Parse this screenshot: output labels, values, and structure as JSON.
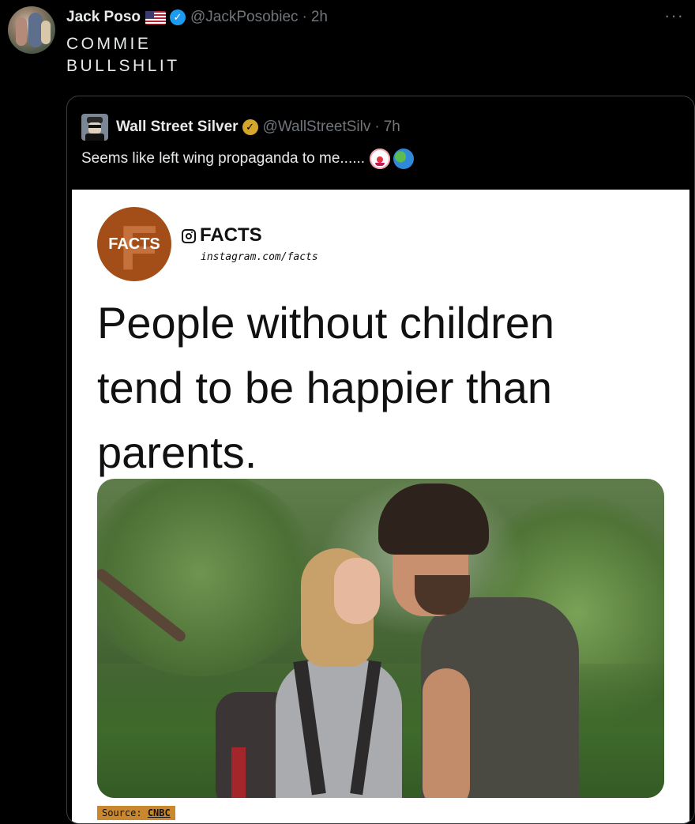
{
  "tweet": {
    "author_name": "Jack Poso",
    "author_handle": "@JackPosobiec",
    "separator": "·",
    "time": "2h",
    "more_label": "···",
    "text_lines": [
      "COMMIE",
      "BULLSHLIT"
    ]
  },
  "quoted": {
    "author_name": "Wall Street Silver",
    "author_handle": "@WallStreetSilv",
    "separator": "·",
    "time": "7h",
    "text": "Seems like left wing propaganda to me......",
    "emojis": [
      "clown-face",
      "globe"
    ]
  },
  "card": {
    "logo_text": "FACTS",
    "logo_letter": "F",
    "account_name": "FACTS",
    "account_url": "instagram.com/facts",
    "headline_lines": [
      "People without children",
      "tend to be happier than",
      "parents."
    ],
    "source_label": "Source:",
    "source_name": "CNBC"
  },
  "icons": {
    "flag": "us-flag-icon",
    "verified_blue": "verified-badge-icon",
    "verified_gold": "gold-verified-badge-icon",
    "instagram": "instagram-icon"
  },
  "colors": {
    "background": "#000000",
    "text_primary": "#e7e9ea",
    "text_secondary": "#71767b",
    "verified_blue": "#1d9bf0",
    "verified_gold": "#d4a72c",
    "facts_brand": "#a34e18"
  }
}
